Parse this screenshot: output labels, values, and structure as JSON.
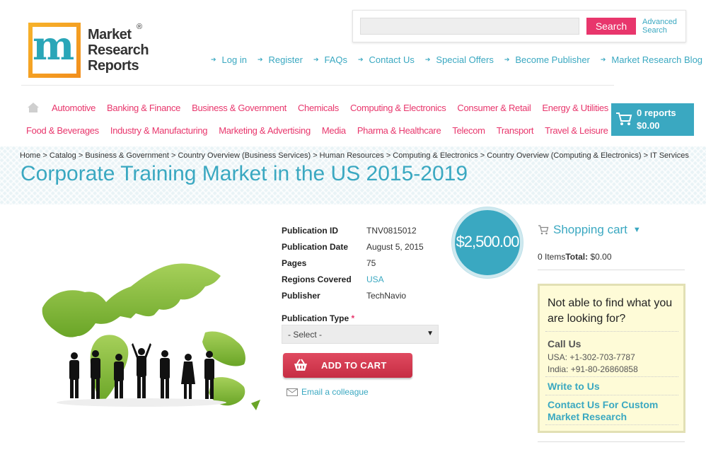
{
  "logo": {
    "line1": "Market",
    "line2": "Research",
    "line3": "Reports",
    "reg": "®"
  },
  "search": {
    "placeholder": "",
    "button_label": "Search",
    "advanced_line1": "Advanced",
    "advanced_line2": "Search"
  },
  "top_links": [
    {
      "label": "Log in"
    },
    {
      "label": "Register"
    },
    {
      "label": "FAQs"
    },
    {
      "label": "Contact Us"
    },
    {
      "label": "Special Offers"
    },
    {
      "label": "Become Publisher"
    },
    {
      "label": "Market Research Blog"
    }
  ],
  "categories_row1": [
    "Automotive",
    "Banking & Finance",
    "Business & Government",
    "Chemicals",
    "Computing & Electronics",
    "Consumer & Retail",
    "Energy & Utilities"
  ],
  "categories_row2": [
    "Food & Beverages",
    "Industry & Manufacturing",
    "Marketing & Advertising",
    "Media",
    "Pharma & Healthcare",
    "Telecom",
    "Transport",
    "Travel & Leisure"
  ],
  "cart": {
    "count": "0 reports",
    "total": "$0.00"
  },
  "breadcrumb": "Home > Catalog > Business & Government > Country Overview (Business Services) > Human Resources > Computing & Electronics > Country Overview (Computing & Electronics) > IT Services",
  "page_title": "Corporate Training Market in the US 2015-2019",
  "details": {
    "publication_id_label": "Publication ID",
    "publication_id": "TNV0815012",
    "publication_date_label": "Publication Date",
    "publication_date": "August 5, 2015",
    "pages_label": "Pages",
    "pages": "75",
    "regions_label": "Regions Covered",
    "regions": "USA",
    "publisher_label": "Publisher",
    "publisher": "TechNavio"
  },
  "price": "$2,500.00",
  "publication_type": {
    "label": "Publication Type",
    "required": "*",
    "selected": "- Select -"
  },
  "add_to_cart_label": "ADD TO CART",
  "email_colleague": "Email a colleague",
  "shopping_cart": {
    "title": "Shopping cart",
    "items": "0 Items",
    "total_label": "Total:",
    "total": "$0.00"
  },
  "help": {
    "question": "Not able to find what you are looking for?",
    "call_us": "Call Us",
    "usa": "USA: +1-302-703-7787",
    "india": "India: +91-80-26860858",
    "write_to_us": "Write to Us",
    "custom_research": "Contact Us For Custom Market Research"
  },
  "colors": {
    "accent": "#3aa8c1",
    "pink": "#e8366c",
    "help_bg": "#fefbd7"
  }
}
